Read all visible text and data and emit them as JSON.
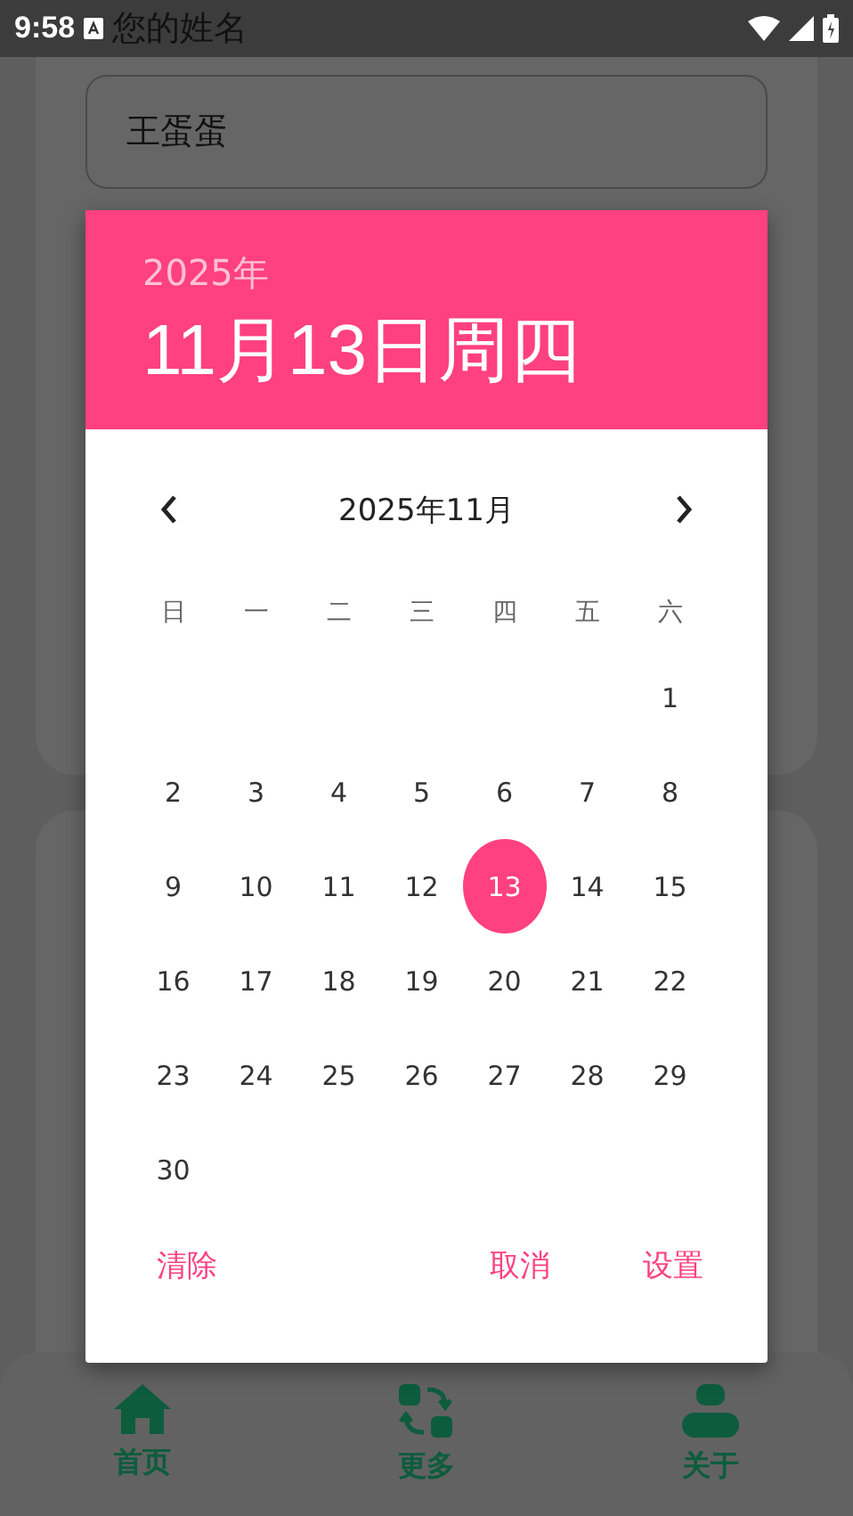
{
  "status_bar": {
    "time": "9:58"
  },
  "form": {
    "label": "您的姓名",
    "name_value": "王蛋蛋"
  },
  "date_picker": {
    "year": "2025年",
    "date": "11月13日周四",
    "month": "2025年11月",
    "weekdays": [
      "日",
      "一",
      "二",
      "三",
      "四",
      "五",
      "六"
    ],
    "weeks": [
      {
        "days": [
          {
            "label": "1",
            "selected": false
          }
        ]
      },
      {
        "days": [
          {
            "label": "2",
            "selected": false
          },
          {
            "label": "3",
            "selected": false
          },
          {
            "label": "4",
            "selected": false
          },
          {
            "label": "5",
            "selected": false
          },
          {
            "label": "6",
            "selected": false
          },
          {
            "label": "7",
            "selected": false
          },
          {
            "label": "8",
            "selected": false
          }
        ]
      },
      {
        "days": [
          {
            "label": "9",
            "selected": false
          },
          {
            "label": "10",
            "selected": false
          },
          {
            "label": "11",
            "selected": false
          },
          {
            "label": "12",
            "selected": false
          },
          {
            "label": "13",
            "selected": true
          },
          {
            "label": "14",
            "selected": false
          },
          {
            "label": "15",
            "selected": false
          }
        ]
      },
      {
        "days": [
          {
            "label": "16",
            "selected": false
          },
          {
            "label": "17",
            "selected": false
          },
          {
            "label": "18",
            "selected": false
          },
          {
            "label": "19",
            "selected": false
          },
          {
            "label": "20",
            "selected": false
          },
          {
            "label": "21",
            "selected": false
          },
          {
            "label": "22",
            "selected": false
          }
        ]
      },
      {
        "days": [
          {
            "label": "23",
            "selected": false
          },
          {
            "label": "24",
            "selected": false
          },
          {
            "label": "25",
            "selected": false
          },
          {
            "label": "26",
            "selected": false
          },
          {
            "label": "27",
            "selected": false
          },
          {
            "label": "28",
            "selected": false
          },
          {
            "label": "29",
            "selected": false
          }
        ]
      },
      {
        "days": [
          {
            "label": "30",
            "selected": false
          }
        ]
      }
    ],
    "buttons": {
      "clear": "清除",
      "cancel": "取消",
      "set": "设置"
    }
  },
  "nav": [
    {
      "kind": "home",
      "label": "首页"
    },
    {
      "kind": "more",
      "label": "更多"
    },
    {
      "kind": "about",
      "label": "关于"
    }
  ]
}
